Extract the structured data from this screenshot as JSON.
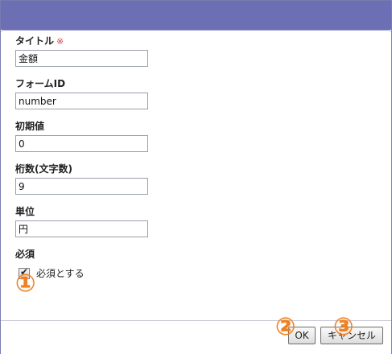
{
  "form": {
    "title_label": "タイトル",
    "title_required_mark": "※",
    "title_value": "金額",
    "form_id_label": "フォームID",
    "form_id_value": "number",
    "initial_value_label": "初期値",
    "initial_value_value": "0",
    "digits_label": "桁数(文字数)",
    "digits_value": "9",
    "unit_label": "単位",
    "unit_value": "円",
    "required_label": "必須",
    "required_checkbox_label": "必須とする",
    "required_checked": true
  },
  "markers": {
    "m1": "①",
    "m2": "②",
    "m3": "③"
  },
  "footer": {
    "ok_label": "OK",
    "cancel_label": "キャンセル"
  },
  "colors": {
    "titlebar": "#6c6fb3",
    "marker": "#f08020",
    "required_mark": "#d04040"
  }
}
